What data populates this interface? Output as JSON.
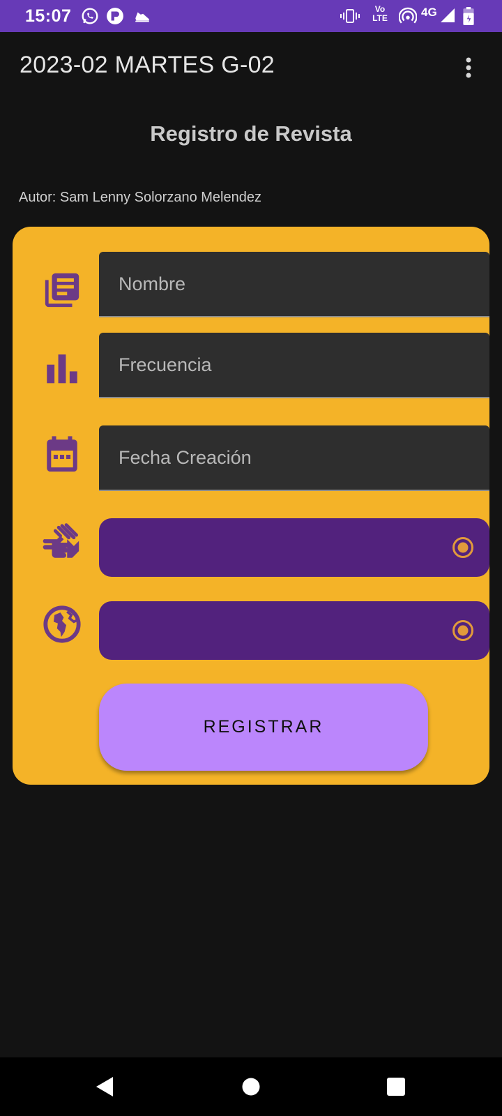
{
  "status_bar": {
    "time": "15:07",
    "notification_icons": [
      "whatsapp-icon",
      "app-p-icon",
      "shoe-icon"
    ],
    "system_icons": [
      "vibrate-icon",
      "volte-icon",
      "hotspot-icon",
      "signal-4g-icon",
      "battery-icon"
    ],
    "network_label": "4G",
    "volte_label_top": "Vo",
    "volte_label_bottom": "LTE"
  },
  "app_bar": {
    "title": "2023-02 MARTES G-02",
    "menu_icon": "more-vertical-icon"
  },
  "page": {
    "title": "Registro de Revista",
    "author": "Autor: Sam Lenny Solorzano Melendez"
  },
  "form": {
    "fields": [
      {
        "icon": "newspaper-icon",
        "placeholder": "Nombre",
        "value": ""
      },
      {
        "icon": "bar-chart-icon",
        "placeholder": "Frecuencia",
        "value": ""
      },
      {
        "icon": "calendar-icon",
        "placeholder": "Fecha Creación",
        "value": ""
      }
    ],
    "spinners": [
      {
        "icon": "sign-language-icon",
        "selected": ""
      },
      {
        "icon": "globe-icon",
        "selected": ""
      }
    ],
    "submit_label": "REGISTRAR"
  },
  "colors": {
    "status_bar": "#673ab7",
    "background": "#131313",
    "card": "#f4b328",
    "icon_purple": "#6c3a86",
    "spinner": "#52227d",
    "button": "#bb86fc",
    "radio": "#e29a3b"
  },
  "nav_bar": {
    "buttons": [
      "back-icon",
      "home-icon",
      "recents-icon"
    ]
  }
}
